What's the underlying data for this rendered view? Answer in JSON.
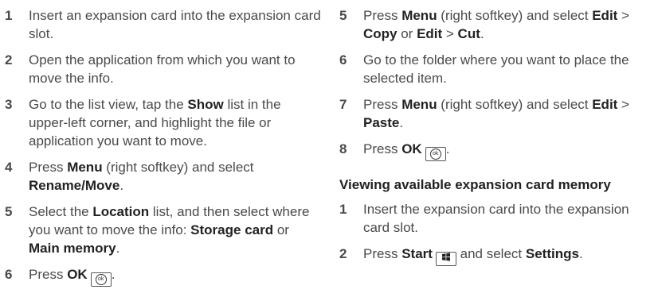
{
  "left_steps": [
    {
      "num": "1",
      "parts": [
        {
          "t": "Insert an expansion card into the expansion card slot.",
          "b": false
        }
      ]
    },
    {
      "num": "2",
      "parts": [
        {
          "t": "Open the application from which you want to move the info.",
          "b": false
        }
      ]
    },
    {
      "num": "3",
      "parts": [
        {
          "t": "Go to the list view, tap the ",
          "b": false
        },
        {
          "t": "Show",
          "b": true
        },
        {
          "t": " list in the upper-left corner, and highlight the file or application you want to move.",
          "b": false
        }
      ]
    },
    {
      "num": "4",
      "parts": [
        {
          "t": "Press ",
          "b": false
        },
        {
          "t": "Menu",
          "b": true
        },
        {
          "t": " (right softkey) and select ",
          "b": false
        },
        {
          "t": "Rename/Move",
          "b": true
        },
        {
          "t": ".",
          "b": false
        }
      ]
    },
    {
      "num": "5",
      "parts": [
        {
          "t": "Select the ",
          "b": false
        },
        {
          "t": "Location",
          "b": true
        },
        {
          "t": " list, and then select where you want to move the info: ",
          "b": false
        },
        {
          "t": "Storage card",
          "b": true
        },
        {
          "t": " or ",
          "b": false
        },
        {
          "t": "Main memory",
          "b": true
        },
        {
          "t": ".",
          "b": false
        }
      ]
    },
    {
      "num": "6",
      "parts": [
        {
          "t": "Press ",
          "b": false
        },
        {
          "t": "OK",
          "b": true
        },
        {
          "key": "ok"
        },
        {
          "t": ".",
          "b": false
        }
      ]
    }
  ],
  "right_steps": [
    {
      "num": "5",
      "parts": [
        {
          "t": "Press ",
          "b": false
        },
        {
          "t": "Menu",
          "b": true
        },
        {
          "t": " (right softkey) and select ",
          "b": false
        },
        {
          "t": "Edit",
          "b": true
        },
        {
          "t": " > ",
          "b": false
        },
        {
          "t": "Copy",
          "b": true
        },
        {
          "t": " or ",
          "b": false
        },
        {
          "t": "Edit",
          "b": true
        },
        {
          "t": " > ",
          "b": false
        },
        {
          "t": "Cut",
          "b": true
        },
        {
          "t": ".",
          "b": false
        }
      ]
    },
    {
      "num": "6",
      "parts": [
        {
          "t": "Go to the folder where you want to place the selected item.",
          "b": false
        }
      ]
    },
    {
      "num": "7",
      "parts": [
        {
          "t": "Press ",
          "b": false
        },
        {
          "t": "Menu",
          "b": true
        },
        {
          "t": " (right softkey) and select ",
          "b": false
        },
        {
          "t": "Edit",
          "b": true
        },
        {
          "t": " > ",
          "b": false
        },
        {
          "t": "Paste",
          "b": true
        },
        {
          "t": ".",
          "b": false
        }
      ]
    },
    {
      "num": "8",
      "parts": [
        {
          "t": "Press ",
          "b": false
        },
        {
          "t": "OK",
          "b": true
        },
        {
          "key": "ok"
        },
        {
          "t": ".",
          "b": false
        }
      ]
    }
  ],
  "section_heading": "Viewing available expansion card memory",
  "section_steps": [
    {
      "num": "1",
      "parts": [
        {
          "t": "Insert the expansion card into the expansion card slot.",
          "b": false
        }
      ]
    },
    {
      "num": "2",
      "parts": [
        {
          "t": "Press ",
          "b": false
        },
        {
          "t": "Start",
          "b": true
        },
        {
          "key": "start"
        },
        {
          "t": " and select ",
          "b": false
        },
        {
          "t": "Settings",
          "b": true
        },
        {
          "t": ".",
          "b": false
        }
      ]
    }
  ],
  "icons": {
    "ok": "ok-key-icon",
    "start": "windows-start-key-icon"
  },
  "colors": {
    "body_text": "#4a4a4a",
    "bold_text": "#222222"
  }
}
